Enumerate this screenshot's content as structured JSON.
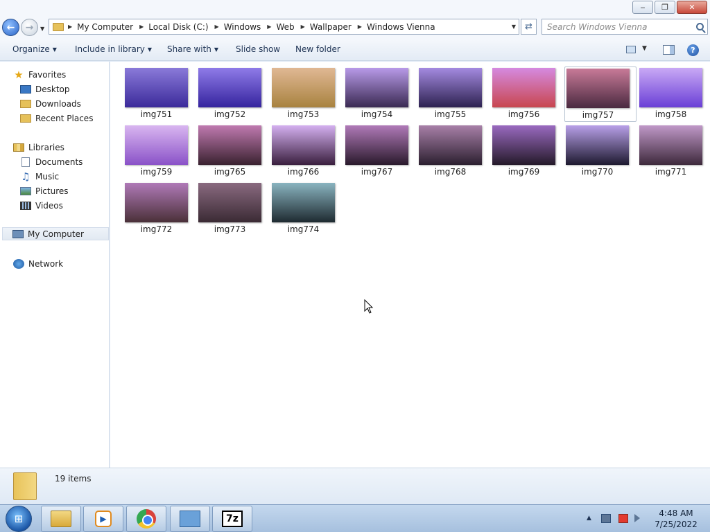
{
  "window": {
    "minimize_label": "‒",
    "maximize_label": "❐",
    "close_label": "✕"
  },
  "address": {
    "crumbs": [
      "My Computer",
      "Local Disk (C:)",
      "Windows",
      "Web",
      "Wallpaper",
      "Windows Vienna"
    ],
    "search_placeholder": "Search Windows Vienna"
  },
  "toolbar": {
    "organize": "Organize",
    "include_in_library": "Include in library",
    "share_with": "Share with",
    "slide_show": "Slide show",
    "new_folder": "New folder"
  },
  "nav": {
    "favorites": "Favorites",
    "desktop": "Desktop",
    "downloads": "Downloads",
    "recent_places": "Recent Places",
    "libraries": "Libraries",
    "documents": "Documents",
    "music": "Music",
    "pictures": "Pictures",
    "videos": "Videos",
    "my_computer": "My Computer",
    "network": "Network"
  },
  "files": [
    {
      "name": "img751",
      "colors": [
        "#8a7ad9",
        "#3b2a9a"
      ]
    },
    {
      "name": "img752",
      "colors": [
        "#8f7be8",
        "#35249e"
      ]
    },
    {
      "name": "img753",
      "colors": [
        "#e0b894",
        "#a8823f"
      ]
    },
    {
      "name": "img754",
      "colors": [
        "#b89ae8",
        "#3a2a52"
      ]
    },
    {
      "name": "img755",
      "colors": [
        "#a48ae0",
        "#2d2250"
      ]
    },
    {
      "name": "img756",
      "colors": [
        "#d58ae0",
        "#c8464e"
      ]
    },
    {
      "name": "img757",
      "colors": [
        "#c87a98",
        "#4a2a40"
      ]
    },
    {
      "name": "img758",
      "colors": [
        "#c9a9f5",
        "#6a3fd6"
      ]
    },
    {
      "name": "img759",
      "colors": [
        "#d9b6f0",
        "#8a52c8"
      ]
    },
    {
      "name": "img765",
      "colors": [
        "#c07ab0",
        "#3a2230"
      ]
    },
    {
      "name": "img766",
      "colors": [
        "#d4b0f0",
        "#3a1f3e"
      ]
    },
    {
      "name": "img767",
      "colors": [
        "#b07ab8",
        "#2a1a2c"
      ]
    },
    {
      "name": "img768",
      "colors": [
        "#a880a8",
        "#2c2030"
      ]
    },
    {
      "name": "img769",
      "colors": [
        "#9a6ac0",
        "#251a2a"
      ]
    },
    {
      "name": "img770",
      "colors": [
        "#b8a0e8",
        "#1e1a30"
      ]
    },
    {
      "name": "img771",
      "colors": [
        "#c098c8",
        "#3e2a3c"
      ]
    },
    {
      "name": "img772",
      "colors": [
        "#b07ab8",
        "#4a3038"
      ]
    },
    {
      "name": "img773",
      "colors": [
        "#8a6a80",
        "#3a2a34"
      ]
    },
    {
      "name": "img774",
      "colors": [
        "#8ab4c0",
        "#1e2a30"
      ]
    }
  ],
  "status": {
    "item_count": "19 items"
  },
  "taskbar": {
    "start_glyph": "⊞",
    "media_glyph": "▶",
    "sevenzip_label": "7z",
    "time": "4:48 AM",
    "date": "7/25/2022"
  },
  "accent": "#3a78c4"
}
